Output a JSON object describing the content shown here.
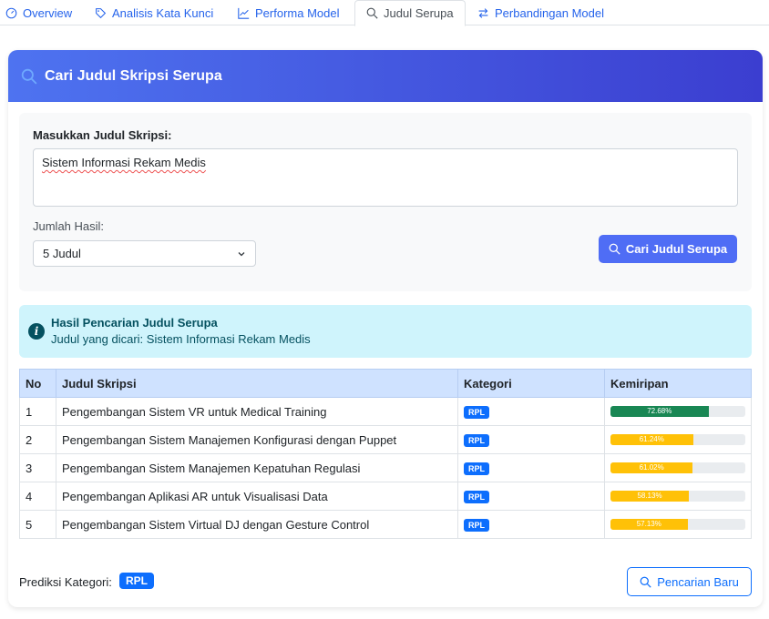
{
  "tabs": [
    {
      "label": "Overview",
      "icon": "speedometer-icon"
    },
    {
      "label": "Analisis Kata Kunci",
      "icon": "tag-icon"
    },
    {
      "label": "Performa Model",
      "icon": "graph-icon"
    },
    {
      "label": "Judul Serupa",
      "icon": "search-icon"
    },
    {
      "label": "Perbandingan Model",
      "icon": "arrows-swap-icon"
    }
  ],
  "active_tab": "Judul Serupa",
  "card": {
    "title": "Cari Judul Skripsi Serupa",
    "form": {
      "title_label": "Masukkan Judul Skripsi:",
      "title_value": "Sistem Informasi Rekam Medis",
      "count_label": "Jumlah Hasil:",
      "count_value": "5 Judul",
      "search_button": "Cari Judul Serupa"
    },
    "alert": {
      "title": "Hasil Pencarian Judul Serupa",
      "text": "Judul yang dicari: Sistem Informasi Rekam Medis"
    },
    "table": {
      "headers": [
        "No",
        "Judul Skripsi",
        "Kategori",
        "Kemiripan"
      ],
      "rows": [
        {
          "no": "1",
          "title": "Pengembangan Sistem VR untuk Medical Training",
          "category": "RPL",
          "similarity": "72.68%",
          "value": 72.68
        },
        {
          "no": "2",
          "title": "Pengembangan Sistem Manajemen Konfigurasi dengan Puppet",
          "category": "RPL",
          "similarity": "61.24%",
          "value": 61.24
        },
        {
          "no": "3",
          "title": "Pengembangan Sistem Manajemen Kepatuhan Regulasi",
          "category": "RPL",
          "similarity": "61.02%",
          "value": 61.02
        },
        {
          "no": "4",
          "title": "Pengembangan Aplikasi AR untuk Visualisasi Data",
          "category": "RPL",
          "similarity": "58.13%",
          "value": 58.13
        },
        {
          "no": "5",
          "title": "Pengembangan Sistem Virtual DJ dengan Gesture Control",
          "category": "RPL",
          "similarity": "57.13%",
          "value": 57.13
        }
      ]
    },
    "footer": {
      "prediction_label": "Prediksi Kategori:",
      "prediction_value": "RPL",
      "new_search_button": "Pencarian Baru"
    }
  },
  "colors": {
    "accent": "#4f6df5",
    "bar_green": "#198754",
    "bar_yellow": "#ffc107",
    "badge": "#0d6efd"
  }
}
